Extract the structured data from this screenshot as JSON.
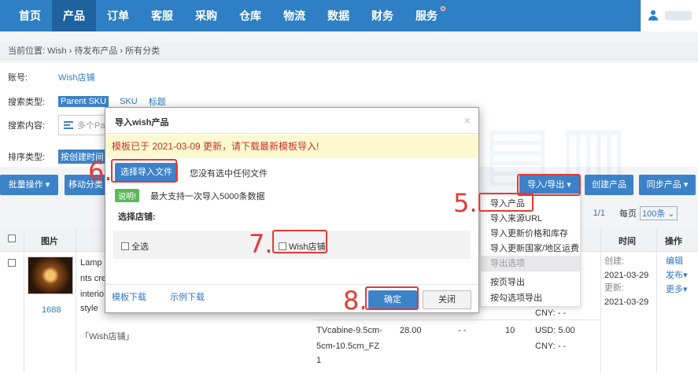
{
  "nav": {
    "items": [
      "首页",
      "产品",
      "订单",
      "客服",
      "采购",
      "仓库",
      "物流",
      "数据",
      "财务",
      "服务"
    ],
    "active_index": 1
  },
  "breadcrumb": "当前位置: Wish › 待发布产品 › 所有分类",
  "filter": {
    "account_label": "账号:",
    "account_value": "Wish店铺",
    "search_type_label": "搜索类型:",
    "search_types": [
      "Parent SKU",
      "SKU",
      "标题"
    ],
    "search_content_label": "搜索内容:",
    "search_placeholder": "多个Pa",
    "sort_type_label": "排序类型:",
    "sort_value": "按创建时间"
  },
  "toolbar": {
    "bulk_ops": "批量操作 ▾",
    "move_category": "移动分类",
    "import_export": "导入/导出 ▾",
    "create_product": "创建产品",
    "sync_product": "同步产品 ▾"
  },
  "pager": {
    "page": "1/1",
    "per_page_label": "每页",
    "per_page_value": "100条"
  },
  "table": {
    "col_image": "图片",
    "col_time": "时间",
    "col_ops": "操作",
    "row": {
      "image_count": "1688",
      "title_lines": [
        "Lamp",
        "nts cre",
        "interio",
        "style"
      ],
      "store_tag": "「Wish店铺」",
      "variant1_tail": "CNY: - -",
      "variant2_name": [
        "TVcabine-9.5cm-",
        "5cm-10.5cm_FZ",
        "1"
      ],
      "variant2_price": "28.00",
      "variant2_dash": "- -",
      "variant2_qty": "10",
      "variant2_usd": "USD: 5.00",
      "variant2_cny": "CNY: - -",
      "created_label": "创建:",
      "created_date": "2021-03-29",
      "updated_label": "更新:",
      "updated_date": "2021-03-29",
      "op_edit": "编辑",
      "op_publish": "发布▾",
      "op_more": "更多▾"
    }
  },
  "dropdown": {
    "items": [
      "导入产品",
      "导入来源URL",
      "导入更新价格和库存",
      "导入更新国家/地区运费"
    ],
    "export_section": "导出选项",
    "export_items": [
      "按页导出",
      "按勾选项导出"
    ]
  },
  "modal": {
    "title": "导入wish产品",
    "close": "×",
    "warning": "模板已于 2021-03-09 更新，请下载最新模板导入!",
    "choose_file": "选择导入文件",
    "no_file": "您没有选中任何文件",
    "note_tag": "说明!",
    "note_text": "最大支持一次导入5000条数据",
    "choose_store_label": "选择店铺:",
    "select_all": "全选",
    "store_name": "Wish店铺",
    "template_download": "模板下载",
    "example_download": "示例下载",
    "confirm": "确定",
    "cancel": "关闭"
  },
  "annotations": {
    "step5": "5.",
    "step6": "6.",
    "step7": "7.",
    "step8": "8."
  }
}
